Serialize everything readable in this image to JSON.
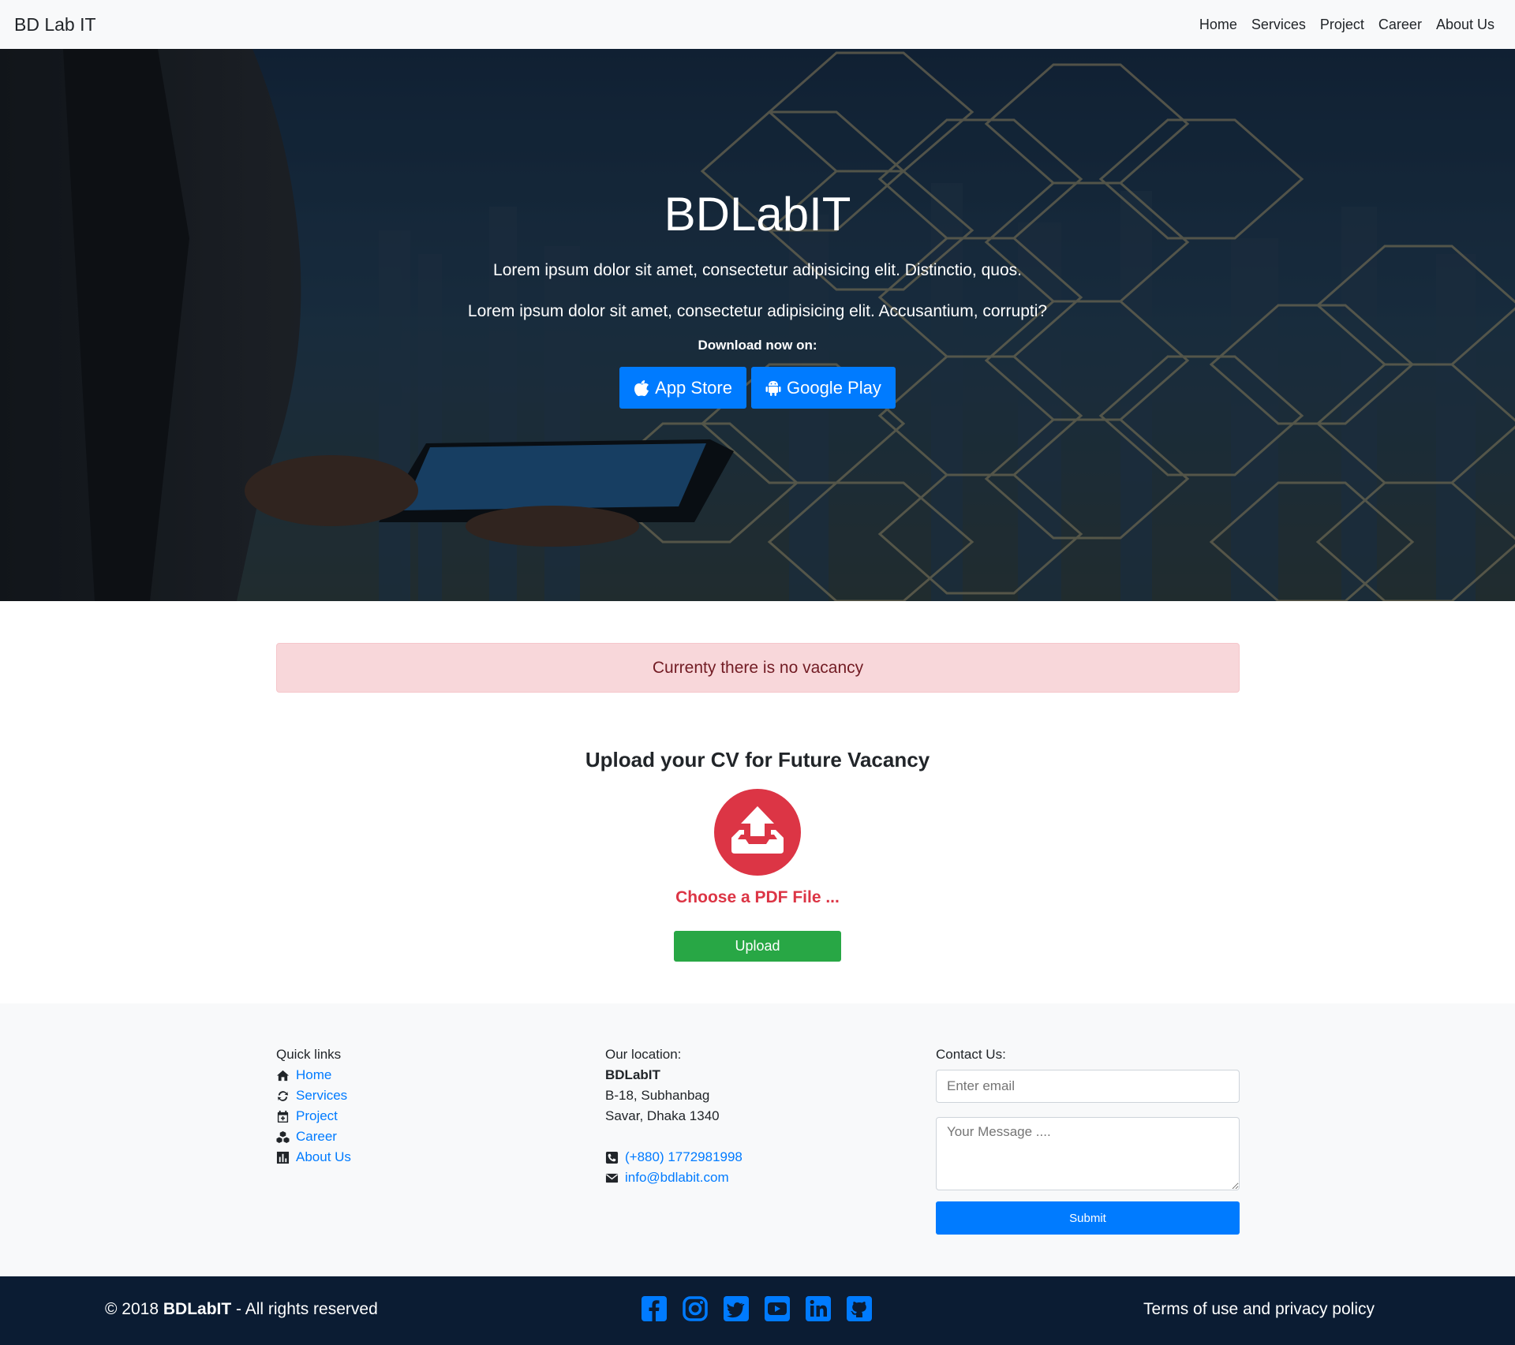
{
  "navbar": {
    "brand": "BD Lab IT",
    "links": [
      "Home",
      "Services",
      "Project",
      "Career",
      "About Us"
    ]
  },
  "hero": {
    "title": "BDLabIT",
    "subtitle1": "Lorem ipsum dolor sit amet, consectetur adipisicing elit. Distinctio, quos.",
    "subtitle2": "Lorem ipsum dolor sit amet, consectetur adipisicing elit. Accusantium, corrupti?",
    "download_label": "Download now on:",
    "app_store_label": "App Store",
    "google_play_label": "Google Play"
  },
  "alert": {
    "text": "Currenty there is no vacancy"
  },
  "upload": {
    "title": "Upload your CV for Future Vacancy",
    "choose_label": "Choose a PDF File ...",
    "button_label": "Upload"
  },
  "footer": {
    "quick_links_title": "Quick links",
    "quick_links": [
      "Home",
      "Services",
      "Project",
      "Career",
      "About Us"
    ],
    "location_title": "Our location:",
    "company": "BDLabIT",
    "address_line1": "B-18, Subhanbag",
    "address_line2": "Savar, Dhaka 1340",
    "phone": "(+880) 1772981998",
    "email": "info@bdlabit.com",
    "contact_title": "Contact Us:",
    "email_placeholder": "Enter email",
    "message_placeholder": "Your Message ....",
    "submit_label": "Submit"
  },
  "bottom": {
    "copyright_prefix": "© 2018 ",
    "copyright_brand": "BDLabIT",
    "copyright_suffix": " - All rights reserved",
    "terms": "Terms of use and privacy policy",
    "socials": [
      "facebook-icon",
      "instagram-icon",
      "twitter-icon",
      "youtube-icon",
      "linkedin-icon",
      "github-icon"
    ]
  },
  "colors": {
    "primary": "#007bff",
    "danger": "#dc3545",
    "success": "#28a745",
    "footer_dark": "#0b1c33",
    "alert_bg": "#f8d7da"
  }
}
